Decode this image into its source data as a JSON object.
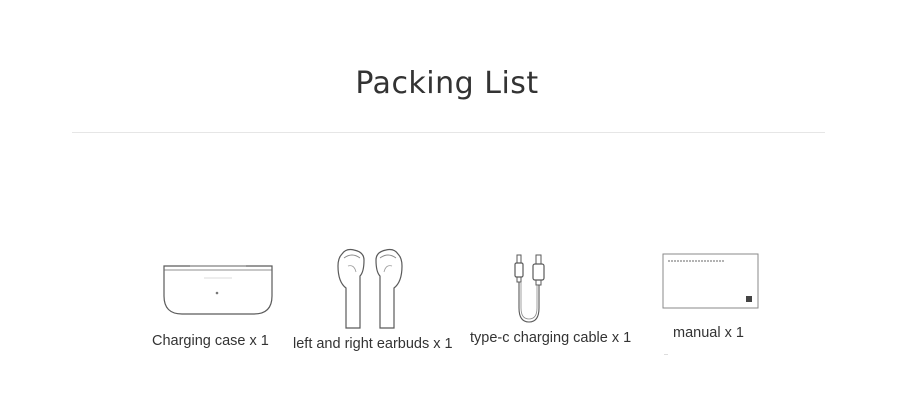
{
  "page": {
    "title": "Packing List"
  },
  "items": [
    {
      "name": "charging-case",
      "caption": "Charging case x 1"
    },
    {
      "name": "earbuds",
      "caption": "left and right earbuds x 1"
    },
    {
      "name": "cable",
      "caption": "type-c charging cable x 1"
    },
    {
      "name": "manual",
      "caption": "manual x 1"
    }
  ]
}
